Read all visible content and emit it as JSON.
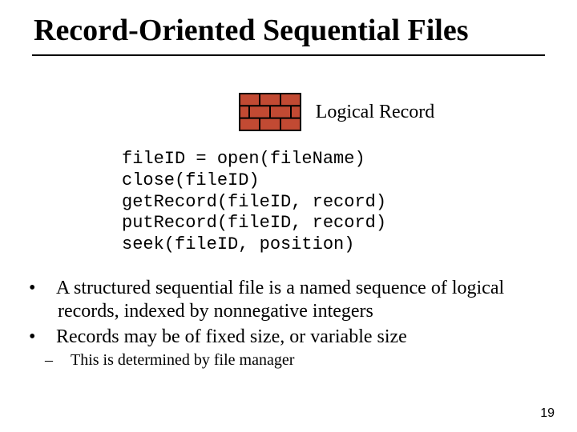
{
  "title": "Record-Oriented Sequential Files",
  "diagram": {
    "icon": "brick-wall-icon",
    "label": "Logical Record",
    "brick_color": "#c24a33",
    "brick_stroke": "#000000"
  },
  "code": {
    "lines": [
      "fileID = open(fileName)",
      "close(fileID)",
      "getRecord(fileID, record)",
      "putRecord(fileID, record)",
      "seek(fileID, position)"
    ]
  },
  "bullets": {
    "l1": [
      "A structured sequential file is a named sequence of logical records, indexed by nonnegative integers",
      "Records may be of fixed size, or variable size"
    ],
    "l2": [
      "This is determined by file manager"
    ]
  },
  "page_number": "19"
}
